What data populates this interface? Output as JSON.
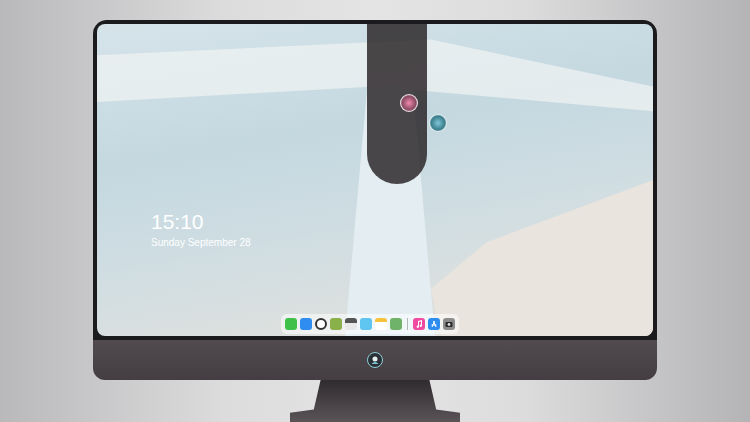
{
  "lock_screen": {
    "time": "15:10",
    "date": "Sunday September 28"
  }
}
